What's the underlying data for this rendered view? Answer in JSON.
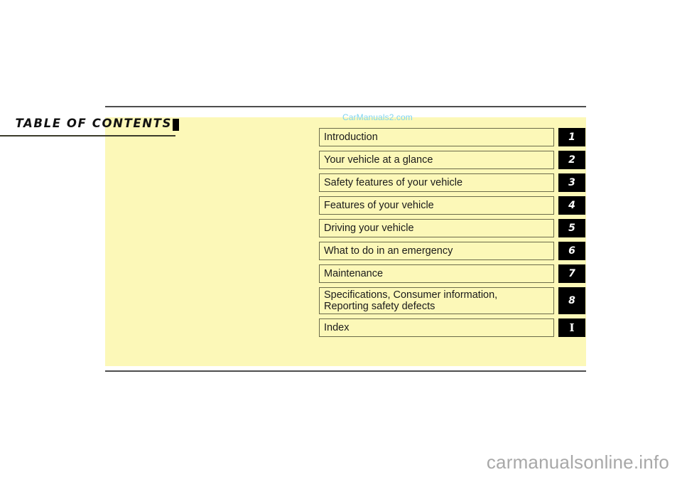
{
  "page": {
    "title": "TABLE OF CONTENTS",
    "panel_color": "#fcf8b8",
    "rule_color": "#4d4d4d"
  },
  "watermarks": {
    "top": "CarManuals2.com",
    "top_color": "#7fd4f0",
    "bottom": "carmanualsonline.info",
    "bottom_color": "#a8a8a8"
  },
  "contents": {
    "entries": [
      {
        "label": "Introduction",
        "badge": "1",
        "tall": false
      },
      {
        "label": "Your vehicle at a glance",
        "badge": "2",
        "tall": false
      },
      {
        "label": "Safety features of your vehicle",
        "badge": "3",
        "tall": false
      },
      {
        "label": "Features of your vehicle",
        "badge": "4",
        "tall": false
      },
      {
        "label": "Driving your vehicle",
        "badge": "5",
        "tall": false
      },
      {
        "label": "What to do in an emergency",
        "badge": "6",
        "tall": false
      },
      {
        "label": "Maintenance",
        "badge": "7",
        "tall": false
      },
      {
        "label": "Specifications, Consumer information,\nReporting safety defects",
        "badge": "8",
        "tall": true
      },
      {
        "label": "Index",
        "badge": "I",
        "tall": false
      }
    ]
  }
}
